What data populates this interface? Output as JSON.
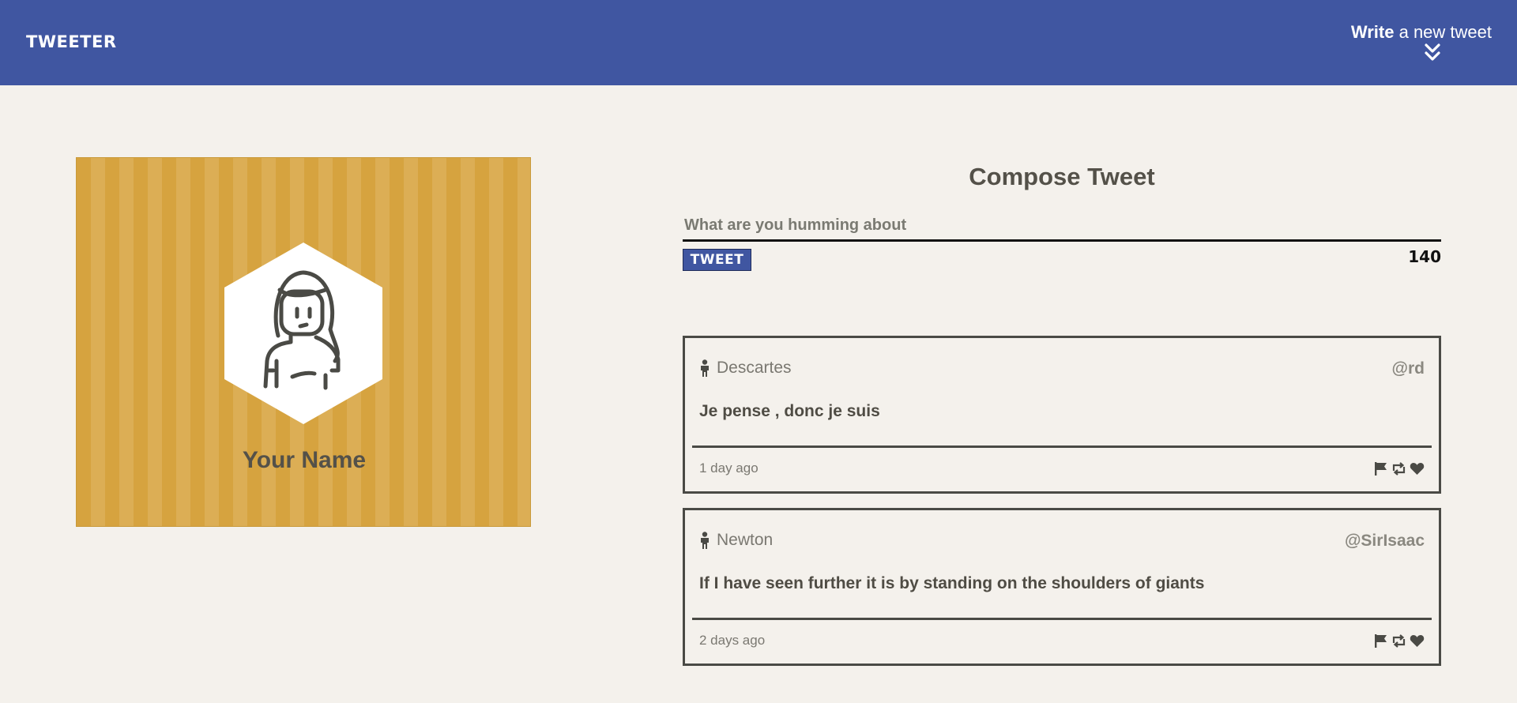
{
  "header": {
    "brand": "TWEETER",
    "write_bold": "Write",
    "write_rest": " a new tweet",
    "toggle_icon": "double-chevron-down-icon"
  },
  "profile": {
    "avatar_icon": "person-avatar-icon",
    "name": "Your Name",
    "colors": {
      "stripe_a": "#d6a33f",
      "stripe_b": "#dcae55"
    }
  },
  "compose": {
    "title": "Compose Tweet",
    "placeholder": "What are you humming about",
    "button_label": "TWEET",
    "counter": "140"
  },
  "tweets": [
    {
      "user_icon": "person-icon",
      "name": "Descartes",
      "handle": "@rd",
      "text": "Je pense , donc je suis",
      "time": "1 day ago",
      "actions": [
        "flag-icon",
        "retweet-icon",
        "heart-icon"
      ]
    },
    {
      "user_icon": "person-icon",
      "name": "Newton",
      "handle": "@SirIsaac",
      "text": "If I have seen further it is by standing on the shoulders of giants",
      "time": "2 days ago",
      "actions": [
        "flag-icon",
        "retweet-icon",
        "heart-icon"
      ]
    }
  ],
  "theme": {
    "accent": "#4056a1",
    "background": "#f4f1ec",
    "text": "#4a4a3d"
  }
}
